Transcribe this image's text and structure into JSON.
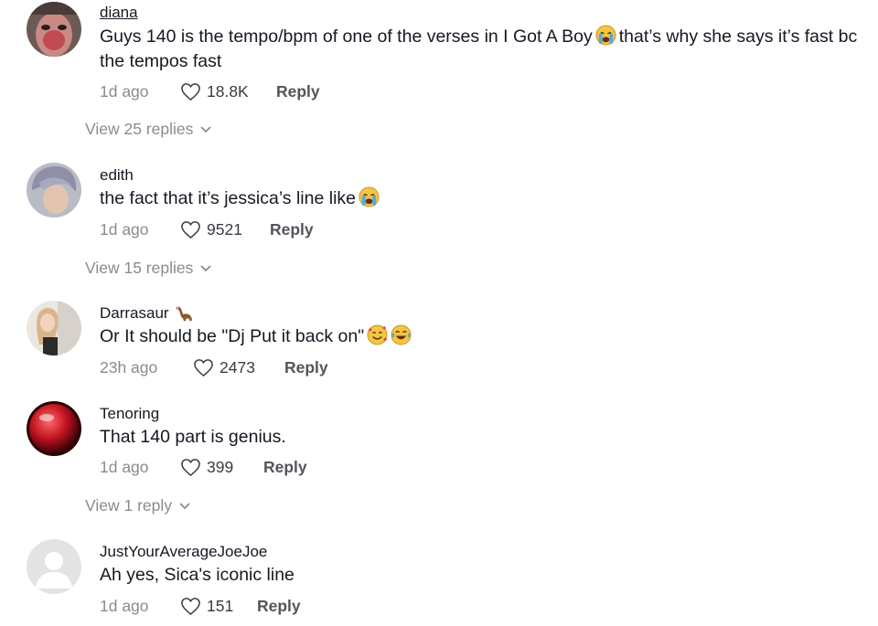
{
  "icons": {
    "like": "heart-outline-icon",
    "expand": "chevron-down-icon",
    "crying": "loudly-crying-face-emoji",
    "hearts": "smiling-face-with-hearts-emoji",
    "tears": "face-with-tears-of-joy-emoji",
    "sauropod": "sauropod-emoji"
  },
  "colors": {
    "text": "#161823",
    "muted": "#8a8b91",
    "reply": "#54555c"
  },
  "comments": [
    {
      "username": "diana",
      "text_a": "Guys 140 is the tempo/bpm of one of the verses in I Got A Boy",
      "text_b": "that’s why she says it’s fast bc the tempos fast",
      "time": "1d ago",
      "likes": "18.8K",
      "reply_label": "Reply",
      "view_replies": "View 25 replies"
    },
    {
      "username": "edith",
      "text_a": "the fact that it’s jessica’s line like",
      "time": "1d ago",
      "likes": "9521",
      "reply_label": "Reply",
      "view_replies": "View 15 replies"
    },
    {
      "username": "Darrasaur",
      "text_a": "Or It should be \"Dj Put it back on\"",
      "time": "23h ago",
      "likes": "2473",
      "reply_label": "Reply"
    },
    {
      "username": "Tenoring",
      "text_a": "That 140 part is genius.",
      "time": "1d ago",
      "likes": "399",
      "reply_label": "Reply",
      "view_replies": "View 1 reply"
    },
    {
      "username": "JustYourAverageJoeJoe",
      "text_a": "Ah yes, Sica's iconic line",
      "time": "1d ago",
      "likes": "151",
      "reply_label": "Reply"
    }
  ]
}
